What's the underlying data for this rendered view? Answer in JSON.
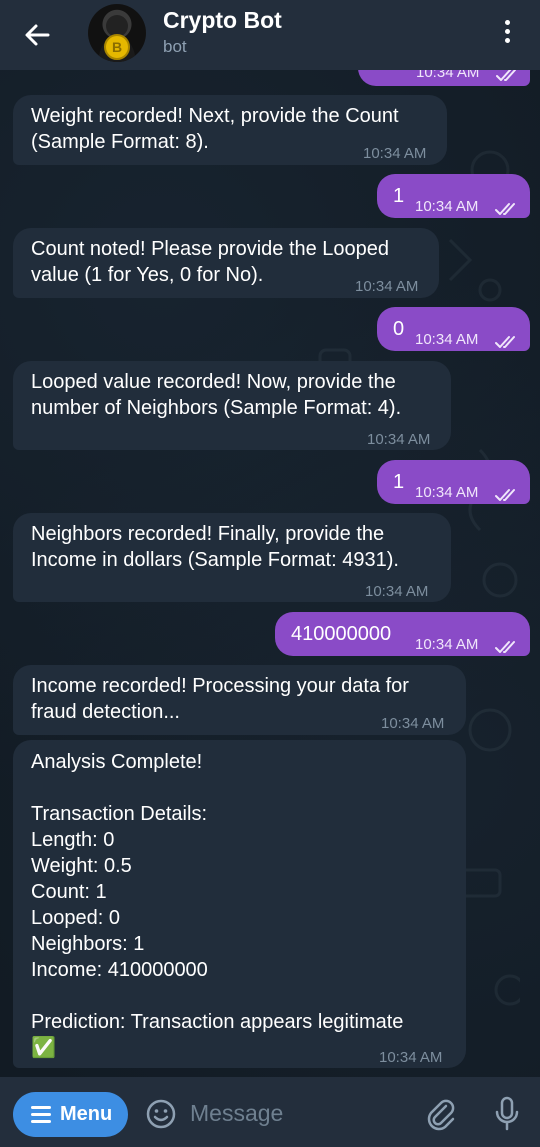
{
  "header": {
    "title": "Crypto Bot",
    "subtitle": "bot",
    "avatar_coin": "B"
  },
  "messages": [
    {
      "dir": "out",
      "text": "",
      "time": "10:34 AM",
      "partial": true
    },
    {
      "dir": "in",
      "lines": [
        "Weight recorded! Next, provide the Count",
        "(Sample Format: 8)."
      ],
      "time": "10:34 AM"
    },
    {
      "dir": "out",
      "text": "1",
      "time": "10:34 AM"
    },
    {
      "dir": "in",
      "lines": [
        "Count noted! Please provide the Looped",
        "value (1 for Yes, 0 for No)."
      ],
      "time": "10:34 AM"
    },
    {
      "dir": "out",
      "text": "0",
      "time": "10:34 AM"
    },
    {
      "dir": "in",
      "lines": [
        "Looped value recorded! Now, provide the",
        "number of Neighbors (Sample Format: 4)."
      ],
      "time": "10:34 AM"
    },
    {
      "dir": "out",
      "text": "1",
      "time": "10:34 AM"
    },
    {
      "dir": "in",
      "lines": [
        "Neighbors recorded! Finally, provide the",
        "Income in dollars (Sample Format: 4931)."
      ],
      "time": "10:34 AM"
    },
    {
      "dir": "out",
      "text": "410000000",
      "time": "10:34 AM"
    },
    {
      "dir": "in",
      "lines": [
        "Income recorded! Processing your data for",
        "fraud detection..."
      ],
      "time": "10:34 AM"
    },
    {
      "dir": "in",
      "lines": [
        "Analysis Complete!",
        "",
        "Transaction Details:",
        "Length: 0",
        "Weight: 0.5",
        "Count: 1",
        "Looped: 0",
        "Neighbors: 1",
        "Income: 410000000",
        "",
        "Prediction: Transaction appears legitimate",
        "✅"
      ],
      "time": "10:34 AM"
    }
  ],
  "input": {
    "menu_label": "Menu",
    "placeholder": "Message"
  },
  "colors": {
    "header_bg": "#232e3c",
    "chat_bg": "#121b24",
    "incoming_bubble": "#212d3b",
    "outgoing_bubble": "#8a4bc7",
    "menu_button": "#3d8ee3"
  }
}
